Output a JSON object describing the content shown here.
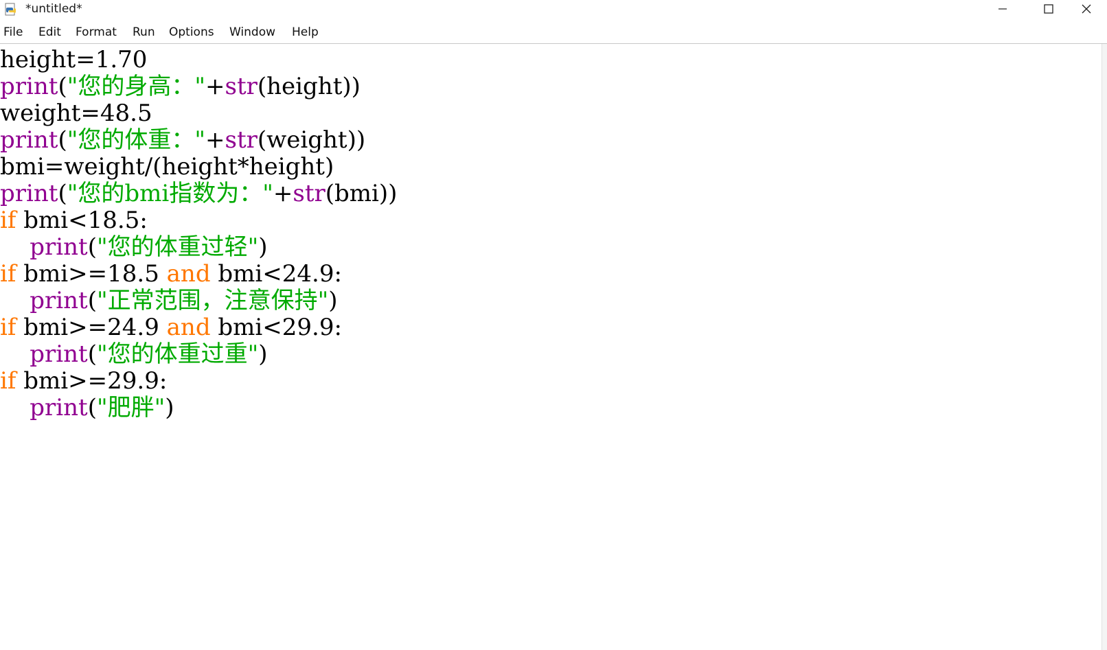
{
  "window": {
    "title": "*untitled*",
    "controls": {
      "minimize": "minimize",
      "maximize": "maximize",
      "close": "close"
    }
  },
  "menu": [
    "File",
    "Edit",
    "Format",
    "Run",
    "Options",
    "Window",
    "Help"
  ],
  "colors": {
    "keyword": "#ff7700",
    "builtin": "#900090",
    "string": "#00aa00",
    "default": "#000000"
  },
  "code": [
    [
      [
        "df",
        "height=1.70"
      ]
    ],
    [
      [
        "bi",
        "print"
      ],
      [
        "df",
        "("
      ],
      [
        "st",
        "\"您的身高：\""
      ],
      [
        "df",
        "+"
      ],
      [
        "bi",
        "str"
      ],
      [
        "df",
        "(height))"
      ]
    ],
    [
      [
        "df",
        "weight=48.5"
      ]
    ],
    [
      [
        "bi",
        "print"
      ],
      [
        "df",
        "("
      ],
      [
        "st",
        "\"您的体重：\""
      ],
      [
        "df",
        "+"
      ],
      [
        "bi",
        "str"
      ],
      [
        "df",
        "(weight))"
      ]
    ],
    [
      [
        "df",
        "bmi=weight/(height*height)"
      ]
    ],
    [
      [
        "bi",
        "print"
      ],
      [
        "df",
        "("
      ],
      [
        "st",
        "\"您的bmi指数为：\""
      ],
      [
        "df",
        "+"
      ],
      [
        "bi",
        "str"
      ],
      [
        "df",
        "(bmi))"
      ]
    ],
    [
      [
        "kw",
        "if"
      ],
      [
        "df",
        " bmi<18.5:"
      ]
    ],
    [
      [
        "df",
        "    "
      ],
      [
        "bi",
        "print"
      ],
      [
        "df",
        "("
      ],
      [
        "st",
        "\"您的体重过轻\""
      ],
      [
        "df",
        ")"
      ]
    ],
    [
      [
        "kw",
        "if"
      ],
      [
        "df",
        " bmi>=18.5 "
      ],
      [
        "kw",
        "and"
      ],
      [
        "df",
        " bmi<24.9:"
      ]
    ],
    [
      [
        "df",
        "    "
      ],
      [
        "bi",
        "print"
      ],
      [
        "df",
        "("
      ],
      [
        "st",
        "\"正常范围，注意保持\""
      ],
      [
        "df",
        ")"
      ]
    ],
    [
      [
        "kw",
        "if"
      ],
      [
        "df",
        " bmi>=24.9 "
      ],
      [
        "kw",
        "and"
      ],
      [
        "df",
        " bmi<29.9:"
      ]
    ],
    [
      [
        "df",
        "    "
      ],
      [
        "bi",
        "print"
      ],
      [
        "df",
        "("
      ],
      [
        "st",
        "\"您的体重过重\""
      ],
      [
        "df",
        ")"
      ]
    ],
    [
      [
        "kw",
        "if"
      ],
      [
        "df",
        " bmi>=29.9:"
      ]
    ],
    [
      [
        "df",
        "    "
      ],
      [
        "bi",
        "print"
      ],
      [
        "df",
        "("
      ],
      [
        "st",
        "\"肥胖\""
      ],
      [
        "df",
        ")"
      ]
    ]
  ]
}
